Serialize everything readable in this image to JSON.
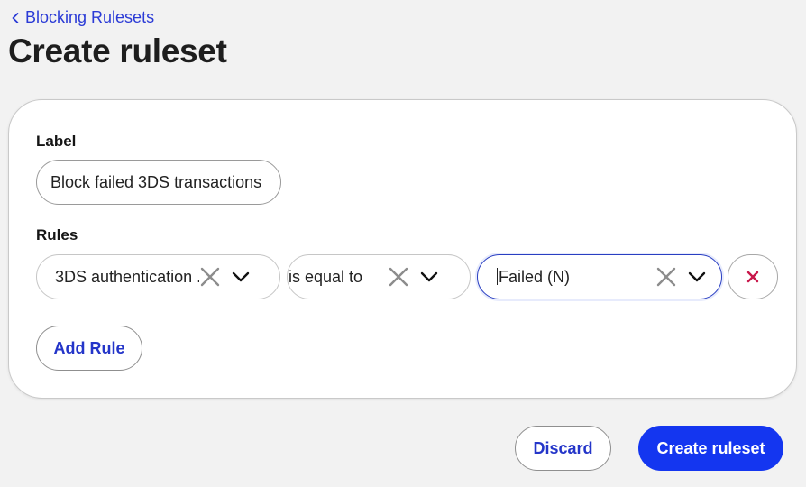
{
  "breadcrumb": {
    "back_label": "Blocking Rulesets",
    "icon": "chevron-left-icon"
  },
  "page": {
    "title": "Create ruleset"
  },
  "form": {
    "label": {
      "heading": "Label",
      "value": "Block failed 3DS transactions"
    },
    "rules": {
      "heading": "Rules",
      "items": [
        {
          "field": "3DS authentication ...",
          "operator": "is equal to",
          "value": "Failed (N)",
          "clear_icon": "clear-x-icon",
          "dropdown_icon": "chevron-down-icon",
          "remove_icon": "remove-x-icon"
        }
      ],
      "add_rule_label": "Add Rule"
    }
  },
  "footer": {
    "discard_label": "Discard",
    "create_label": "Create ruleset"
  },
  "colors": {
    "primary": "#1436f0",
    "link": "#2b3bd6",
    "focus_border": "#2a3fc2",
    "danger": "#c8174a",
    "background": "#f2f2f2"
  }
}
